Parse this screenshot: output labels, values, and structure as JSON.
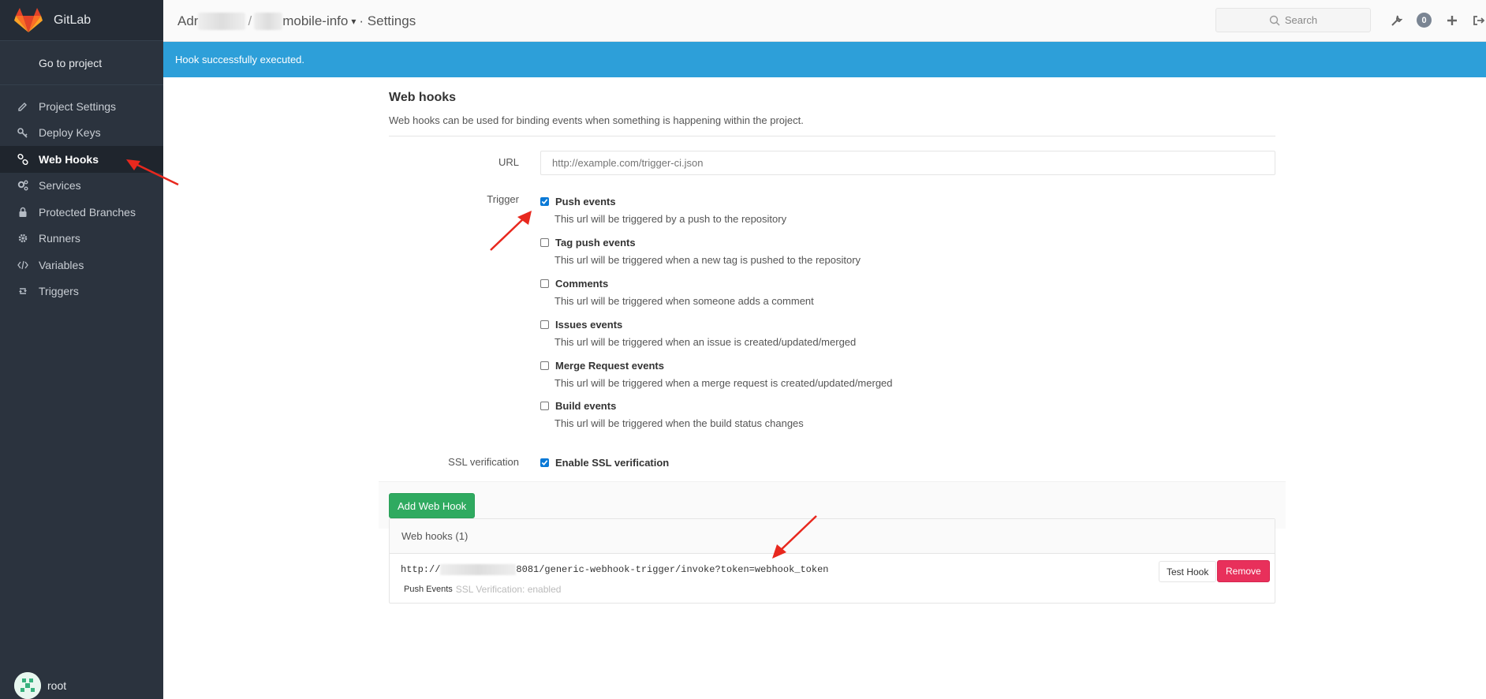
{
  "sidebar": {
    "brand": "GitLab",
    "go_to_project": "Go to project",
    "items": [
      {
        "label": "Project Settings",
        "icon": "edit-icon"
      },
      {
        "label": "Deploy Keys",
        "icon": "key-icon"
      },
      {
        "label": "Web Hooks",
        "icon": "link-icon",
        "active": true
      },
      {
        "label": "Services",
        "icon": "cogs-icon"
      },
      {
        "label": "Protected Branches",
        "icon": "lock-icon"
      },
      {
        "label": "Runners",
        "icon": "gear-icon"
      },
      {
        "label": "Variables",
        "icon": "code-icon"
      },
      {
        "label": "Triggers",
        "icon": "retweet-icon"
      }
    ],
    "user": "root"
  },
  "header": {
    "breadcrumb_start": "Adr",
    "breadcrumb_sep": "/",
    "project_suffix": "mobile-info",
    "settings": "· Settings",
    "search_placeholder": "Search",
    "todo_count": "0"
  },
  "flash": {
    "message": "Hook successfully executed."
  },
  "main": {
    "title": "Web hooks",
    "description": "Web hooks can be used for binding events when something is happening within the project.",
    "url_label": "URL",
    "url_placeholder": "http://example.com/trigger-ci.json",
    "trigger_label": "Trigger",
    "triggers": [
      {
        "label": "Push events",
        "help": "This url will be triggered by a push to the repository",
        "checked": true
      },
      {
        "label": "Tag push events",
        "help": "This url will be triggered when a new tag is pushed to the repository",
        "checked": false
      },
      {
        "label": "Comments",
        "help": "This url will be triggered when someone adds a comment",
        "checked": false
      },
      {
        "label": "Issues events",
        "help": "This url will be triggered when an issue is created/updated/merged",
        "checked": false
      },
      {
        "label": "Merge Request events",
        "help": "This url will be triggered when a merge request is created/updated/merged",
        "checked": false
      },
      {
        "label": "Build events",
        "help": "This url will be triggered when the build status changes",
        "checked": false
      }
    ],
    "ssl_label": "SSL verification",
    "ssl_option": "Enable SSL verification",
    "ssl_checked": true,
    "add_button": "Add Web Hook"
  },
  "hooks": {
    "heading": "Web hooks (1)",
    "items": [
      {
        "url_start": "http://",
        "url_end": "8081/generic-webhook-trigger/invoke?token=webhook_token",
        "tag": "Push Events",
        "ssl": "SSL Verification: enabled",
        "test_label": "Test Hook",
        "remove_label": "Remove"
      }
    ]
  },
  "colors": {
    "sidebar_bg": "#2b333e",
    "flash_bg": "#2d9fd9",
    "add_button": "#2faa60",
    "remove_button": "#e8305b",
    "annotation_arrow": "#e8281e"
  }
}
